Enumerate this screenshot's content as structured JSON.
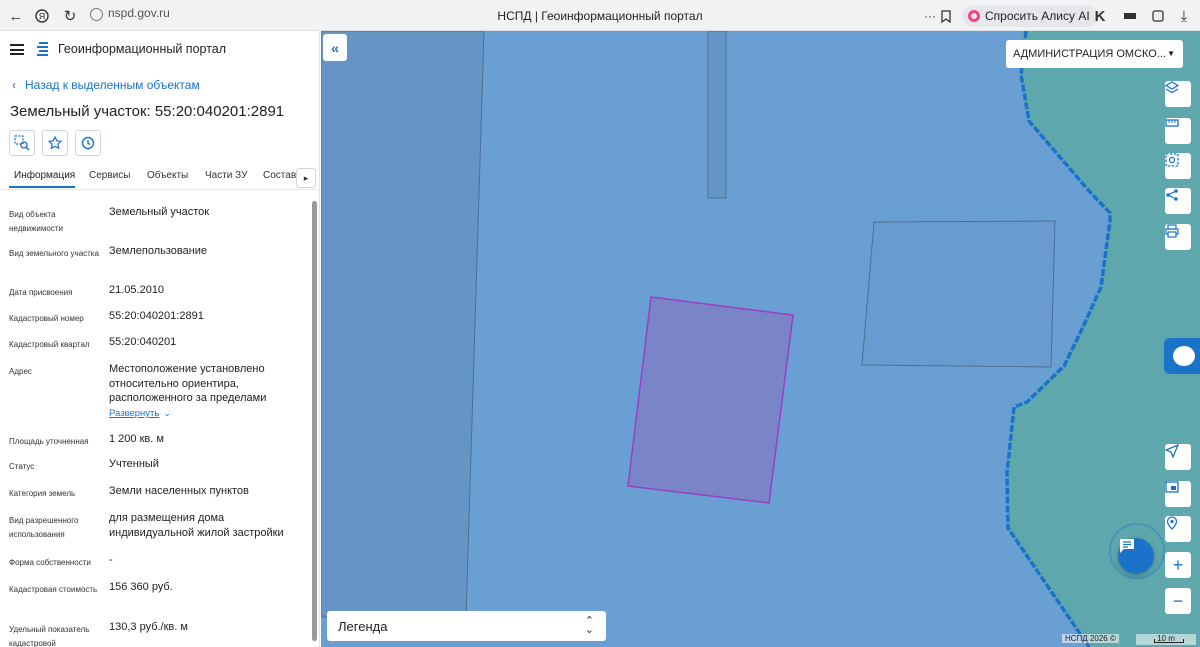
{
  "browser": {
    "url": "nspd.gov.ru",
    "tab_title": "НСПД | Геоинформационный портал",
    "alisa_button": "Спросить Алису AI"
  },
  "header": {
    "app_title": "Геоинформационный портал"
  },
  "panel": {
    "back_link": "Назад к выделенным объектам",
    "object_title": "Земельный участок: 55:20:040201:2891",
    "tabs": [
      {
        "label": "Информация",
        "active": true
      },
      {
        "label": "Сервисы"
      },
      {
        "label": "Объекты"
      },
      {
        "label": "Части ЗУ"
      },
      {
        "label": "Состав"
      }
    ],
    "tab_scroll_icon": "chevron-right-icon",
    "properties": [
      {
        "label": "Вид объекта недвижимости",
        "value": "Земельный участок"
      },
      {
        "label": "Вид земельного участка",
        "value": "Землепользование"
      },
      {
        "label": "Дата присвоения",
        "value": "21.05.2010"
      },
      {
        "label": "Кадастровый номер",
        "value": "55:20:040201:2891"
      },
      {
        "label": "Кадастровый квартал",
        "value": "55:20:040201"
      },
      {
        "label": "Адрес",
        "value": "Местоположение установлено относительно ориентира, расположенного за пределами",
        "link": "Развернуть"
      },
      {
        "label": "Площадь уточненная",
        "value": "1 200 кв. м"
      },
      {
        "label": "Статус",
        "value": "Учтенный"
      },
      {
        "label": "Категория земель",
        "value": "Земли населенных пунктов"
      },
      {
        "label": "Вид разрешенного использования",
        "value": "для размещения дома индивидуальной жилой застройки"
      },
      {
        "label": "Форма собственности",
        "value": "-"
      },
      {
        "label": "Кадастровая стоимость",
        "value": "156 360 руб."
      },
      {
        "label": "Удельный показатель кадастровой",
        "value": "130,3 руб./кв. м"
      }
    ]
  },
  "map": {
    "admin_select": "АДМИНИСТРАЦИЯ ОМСКО...",
    "legend_label": "Легенда",
    "copyright": "НСПД 2026 ©",
    "scale_label": "10 m",
    "colors": {
      "background": "#6a9fd4",
      "highlight_fill": "#7a85c8",
      "highlight_stroke": "#9a3fc0",
      "water": "#5ea7ad",
      "boundary": "#1a73c9",
      "accent": "#1a73c9"
    }
  }
}
